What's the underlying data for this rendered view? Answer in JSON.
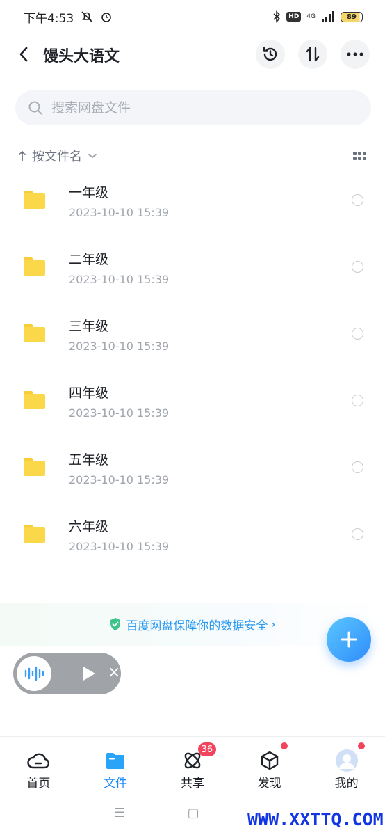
{
  "status_bar": {
    "time": "下午4:53",
    "network": "4G",
    "battery": "89"
  },
  "header": {
    "title": "馒头大语文"
  },
  "search": {
    "placeholder": "搜索网盘文件"
  },
  "sort": {
    "label": "按文件名"
  },
  "files": [
    {
      "name": "一年级",
      "date": "2023-10-10  15:39"
    },
    {
      "name": "二年级",
      "date": "2023-10-10  15:39"
    },
    {
      "name": "三年级",
      "date": "2023-10-10  15:39"
    },
    {
      "name": "四年级",
      "date": "2023-10-10  15:39"
    },
    {
      "name": "五年级",
      "date": "2023-10-10  15:39"
    },
    {
      "name": "六年级",
      "date": "2023-10-10  15:39"
    }
  ],
  "safety_banner": {
    "text": "百度网盘保障你的数据安全"
  },
  "bottom_nav": {
    "items": [
      {
        "label": "首页",
        "icon": "cloud-icon"
      },
      {
        "label": "文件",
        "icon": "folder-icon",
        "active": true
      },
      {
        "label": "共享",
        "icon": "share-atom-icon",
        "badge": "36"
      },
      {
        "label": "发现",
        "icon": "cube-icon",
        "dot": true
      },
      {
        "label": "我的",
        "icon": "avatar-icon",
        "dot": true
      }
    ]
  },
  "watermark": "WWW.XXTTQ.COM",
  "colors": {
    "accent": "#1d8cf8",
    "folder": "#fbd84a",
    "badge": "#f0455c"
  }
}
